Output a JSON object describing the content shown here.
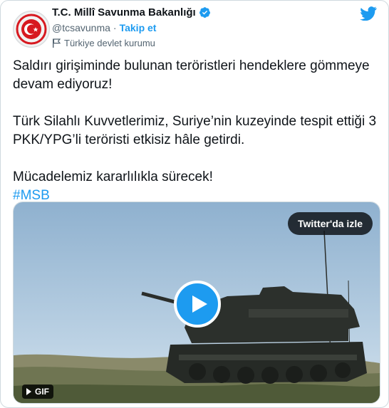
{
  "account": {
    "name": "T.C. Millî Savunma Bakanlığı",
    "handle": "@tcsavunma",
    "separator": "·",
    "follow_label": "Takip et",
    "label": "Türkiye devlet kurumu"
  },
  "tweet": {
    "paragraph1": "Saldırı girişiminde bulunan teröristleri hendeklere gömmeye devam ediyoruz!",
    "paragraph2": "Türk Silahlı Kuvvetlerimiz, Suriye’nin kuzeyinde tespit ettiği 3 PKK/YPG’li teröristi etkisiz hâle getirdi.",
    "paragraph3": "Mücadelemiz kararlılıkla sürecek!",
    "hashtag": "#MSB"
  },
  "media": {
    "watch_label": "Twitter'da izle",
    "gif_label": "GIF"
  },
  "colors": {
    "accent": "#1d9bf0",
    "text": "#0f1419",
    "muted": "#536471",
    "brand_red": "#d71920"
  },
  "icons": {
    "logo": "twitter-bird-icon",
    "verified": "verified-badge-icon",
    "label": "flag-icon",
    "play": "play-icon"
  }
}
